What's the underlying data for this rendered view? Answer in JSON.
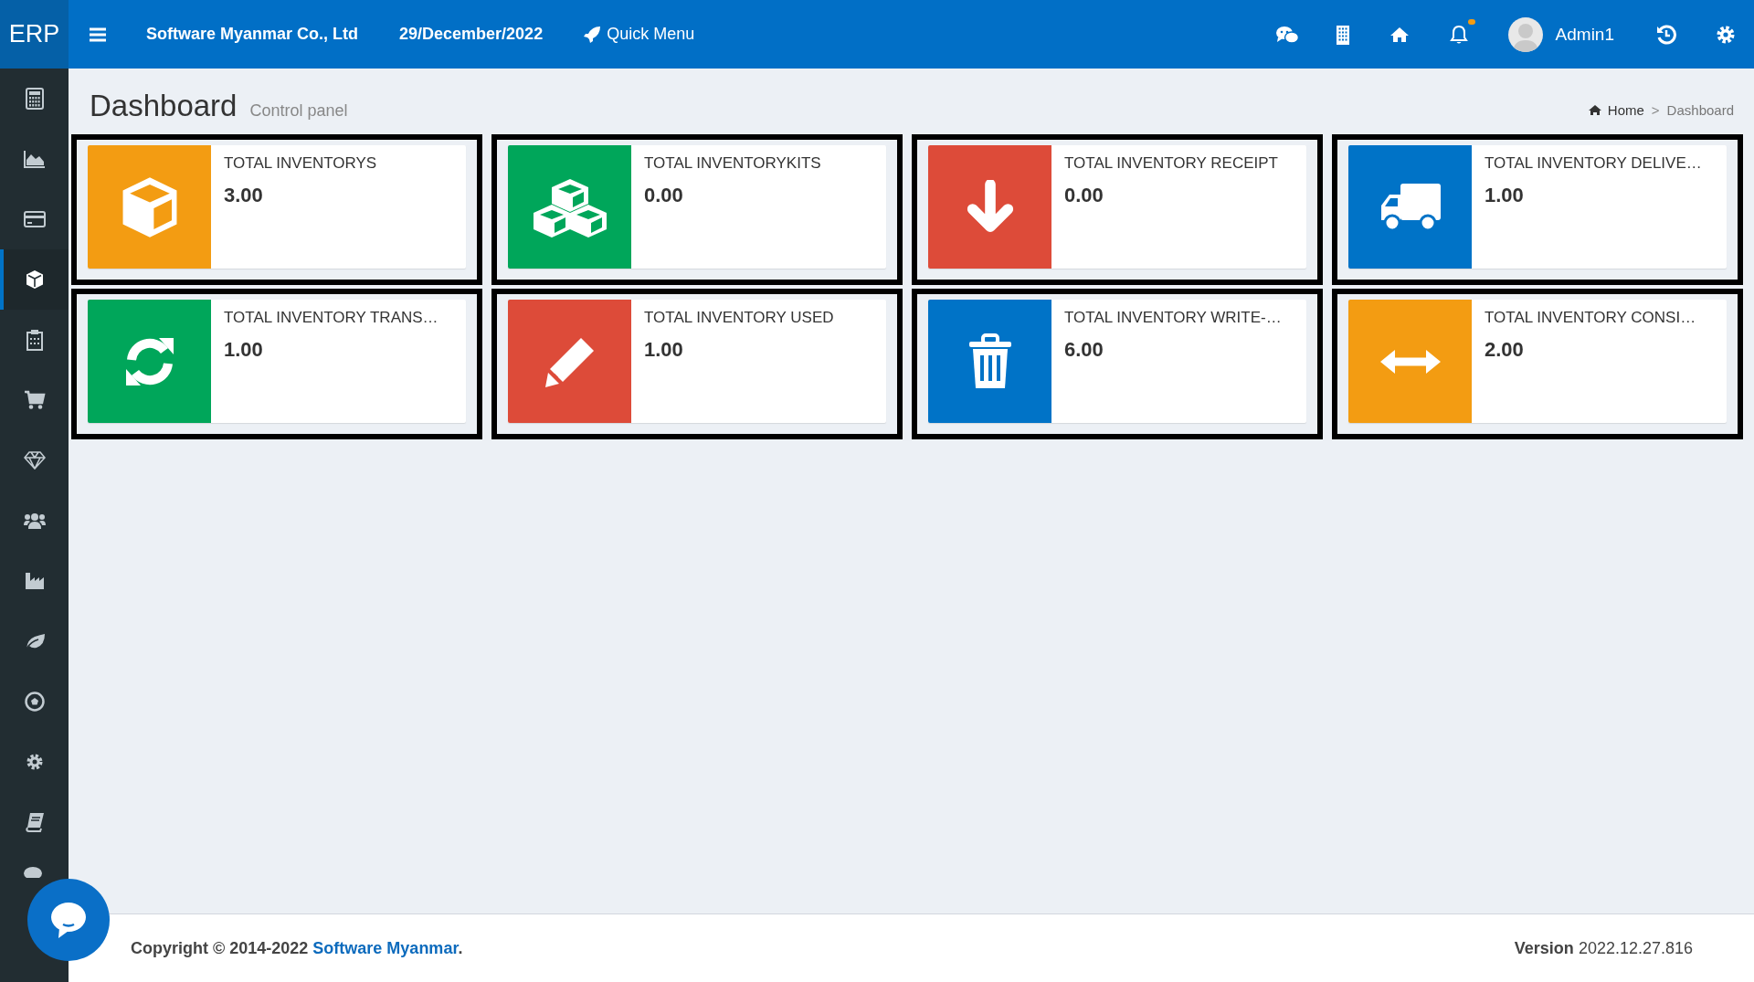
{
  "topbar": {
    "logo": "ERP",
    "company": "Software Myanmar Co., Ltd",
    "date": "29/December/2022",
    "quick_menu": "Quick Menu",
    "notification": true,
    "user": "Admin1"
  },
  "sidebar": {
    "items": [
      {
        "selected": false
      },
      {
        "selected": false
      },
      {
        "selected": false
      },
      {
        "selected": true
      },
      {
        "selected": false
      },
      {
        "selected": false
      },
      {
        "selected": false
      },
      {
        "selected": false
      },
      {
        "selected": false
      },
      {
        "selected": false
      },
      {
        "selected": false
      },
      {
        "selected": false
      },
      {
        "selected": false
      },
      {
        "selected": false
      }
    ]
  },
  "header": {
    "title": "Dashboard",
    "subtitle": "Control panel",
    "breadcrumb": [
      "Home",
      "Dashboard"
    ],
    "breadcrumb_separator": ">"
  },
  "tiles": [
    {
      "title": "TOTAL INVENTORYS",
      "value": "3.00",
      "color": "#f39c12"
    },
    {
      "title": "TOTAL INVENTORYKITS",
      "value": "0.00",
      "color": "#00a65a"
    },
    {
      "title": "TOTAL INVENTORY RECEIPT",
      "value": "0.00",
      "color": "#dd4b39"
    },
    {
      "title": "TOTAL INVENTORY DELIVE…",
      "value": "1.00",
      "color": "#0073c7"
    },
    {
      "title": "TOTAL INVENTORY TRANS…",
      "value": "1.00",
      "color": "#00a65a"
    },
    {
      "title": "TOTAL INVENTORY USED",
      "value": "1.00",
      "color": "#dd4b39"
    },
    {
      "title": "TOTAL INVENTORY WRITE-…",
      "value": "6.00",
      "color": "#0073c7"
    },
    {
      "title": "TOTAL INVENTORY CONSI…",
      "value": "2.00",
      "color": "#f39c12"
    }
  ],
  "footer": {
    "copyright": "Copyright © 2014-2022 ",
    "link": "Software Myanmar",
    "link_end": ".",
    "version_label": "Version",
    "version": "2022.12.27.816"
  }
}
